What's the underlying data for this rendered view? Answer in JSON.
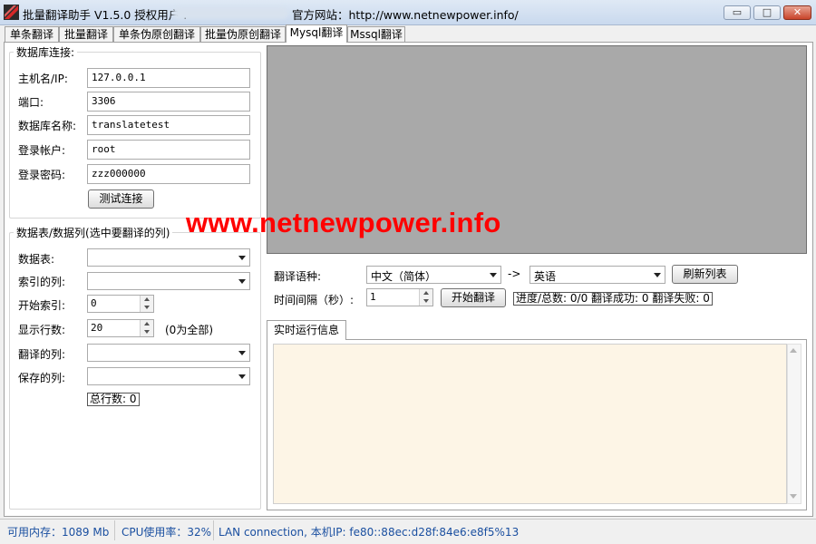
{
  "window": {
    "title": "批量翻译助手 V1.5.0 授权用户 .",
    "site_label": "官方网站：http://www.netnewpower.info/",
    "min_glyph": "▭",
    "max_glyph": "□",
    "close_glyph": "✕"
  },
  "tabs": [
    "单条翻译",
    "批量翻译",
    "单条伪原创翻译",
    "批量伪原创翻译",
    "Mysql翻译",
    "Mssql翻译"
  ],
  "active_tab": "Mysql翻译",
  "db_connection": {
    "title": "数据库连接:",
    "host_label": "主机名/IP:",
    "host_value": "127.0.0.1",
    "port_label": "端口:",
    "port_value": "3306",
    "dbname_label": "数据库名称:",
    "dbname_value": "translatetest",
    "user_label": "登录帐户:",
    "user_value": "root",
    "password_label": "登录密码:",
    "password_value": "zzz000000",
    "test_button": "测试连接"
  },
  "table_section": {
    "title": "数据表/数据列(选中要翻译的列)",
    "table_label": "数据表:",
    "index_col_label": "索引的列:",
    "start_index_label": "开始索引:",
    "start_index_value": "0",
    "rows_label": "显示行数:",
    "rows_value": "20",
    "rows_hint": "(0为全部)",
    "translate_col_label": "翻译的列:",
    "save_col_label": "保存的列:",
    "total_rows": "总行数: 0"
  },
  "watermark": "www.netnewpower.info",
  "controls": {
    "lang_label": "翻译语种:",
    "source_lang": "中文（简体）",
    "arrow": "->",
    "target_lang": "英语",
    "refresh_button": "刷新列表",
    "interval_label": "时间间隔（秒）:",
    "interval_value": "1",
    "start_button": "开始翻译",
    "progress_text": "进度/总数: 0/0 翻译成功: 0 翻译失败: 0"
  },
  "log": {
    "tab_label": "实时运行信息"
  },
  "statusbar": {
    "memory": "可用内存：1089 Mb",
    "cpu": "CPU使用率：32%",
    "network": "LAN connection,  本机IP: fe80::88ec:d28f:84e6:e8f5%13"
  },
  "colors": {
    "watermark": "#ff0000",
    "log_background": "#fdf5e6",
    "preview_background": "#a9a9a9",
    "status_text": "#1a4fa0"
  }
}
